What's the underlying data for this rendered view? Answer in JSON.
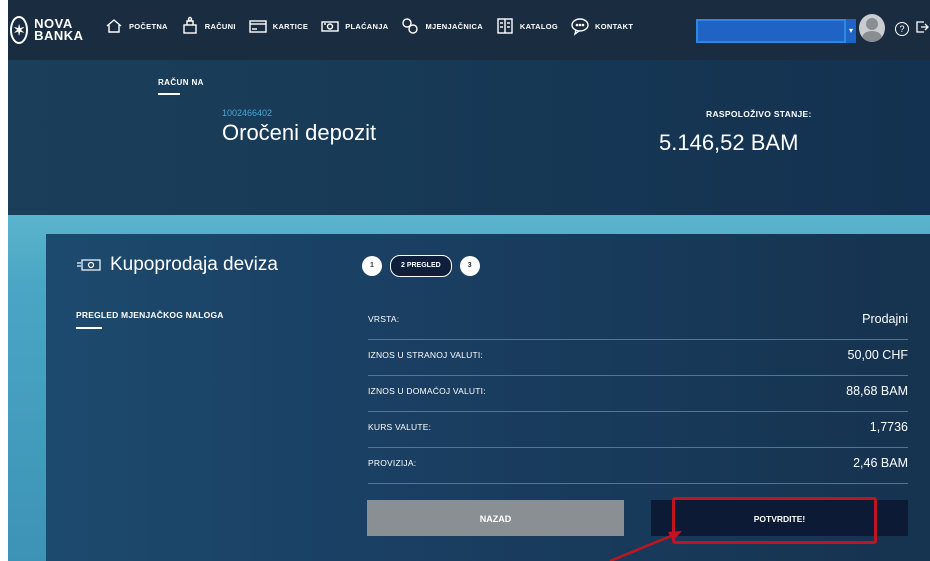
{
  "brand": {
    "logo_text": "NOVA BANKA",
    "accent": "#1f64c4",
    "highlight_color": "#c0151f"
  },
  "nav": {
    "items": [
      {
        "label": "POČETNA",
        "icon": "home-icon"
      },
      {
        "label": "RAČUNI",
        "icon": "wallet-icon"
      },
      {
        "label": "KARTICE",
        "icon": "card-icon"
      },
      {
        "label": "PLAĆANJA",
        "icon": "cash-icon"
      },
      {
        "label": "MJENJAČNICA",
        "icon": "exchange-icon"
      },
      {
        "label": "KATALOG",
        "icon": "catalog-icon"
      },
      {
        "label": "KONTAKT",
        "icon": "chat-icon"
      }
    ],
    "account_select_value": ""
  },
  "account": {
    "label": "RAČUN NA",
    "number": "1002466402",
    "name": "Oročeni depozit",
    "balance_label": "RASPOLOŽIVO STANJE:",
    "balance": "5.146,52 BAM"
  },
  "exchange": {
    "title": "Kupoprodaja deviza",
    "steps": [
      "1",
      "2 PREGLED",
      "3"
    ],
    "subtitle": "PREGLED MJENJAČKOG NALOGA",
    "rows": [
      {
        "label": "VRSTA:",
        "value": "Prodajni"
      },
      {
        "label": "IZNOS U STRANOJ VALUTI:",
        "value": "50,00 CHF"
      },
      {
        "label": "IZNOS U DOMAĆOJ VALUTI:",
        "value": "88,68 BAM"
      },
      {
        "label": "KURS VALUTE:",
        "value": "1,7736"
      },
      {
        "label": "PROVIZIJA:",
        "value": "2,46 BAM"
      }
    ],
    "back_label": "NAZAD",
    "confirm_label": "POTVRDITE!"
  }
}
